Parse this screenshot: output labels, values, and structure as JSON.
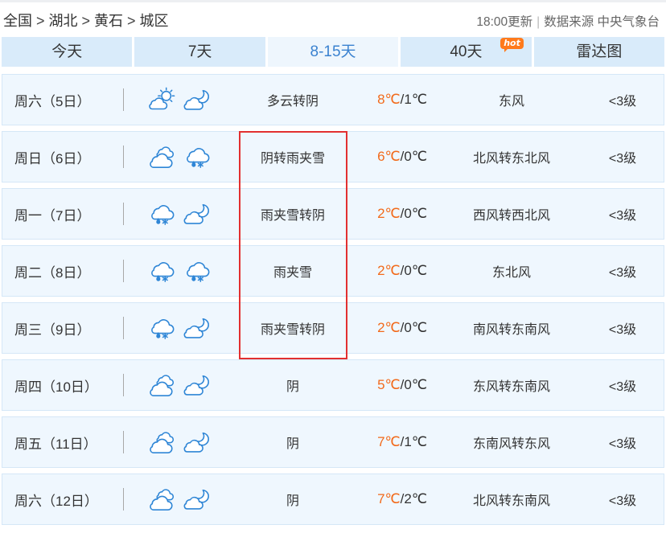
{
  "breadcrumb": {
    "items": [
      "全国",
      "湖北",
      "黄石",
      "城区"
    ],
    "separator": ">"
  },
  "header": {
    "update_time": "18:00更新",
    "divider": "|",
    "source": "数据来源 中央气象台"
  },
  "tabs": [
    {
      "label": "今天"
    },
    {
      "label": "7天"
    },
    {
      "label": "8-15天",
      "active": true
    },
    {
      "label": "40天",
      "badge": "hot"
    },
    {
      "label": "雷达图"
    }
  ],
  "temp_separator": "/",
  "forecast": [
    {
      "day": "周六（5日）",
      "icons": [
        "partly-cloudy-day-icon",
        "cloudy-night-icon"
      ],
      "weather": "多云转阴",
      "high": "8℃",
      "low": "1℃",
      "wind": "东风",
      "level": "<3级"
    },
    {
      "day": "周日（6日）",
      "icons": [
        "overcast-icon",
        "sleet-icon"
      ],
      "weather": "阴转雨夹雪",
      "high": "6℃",
      "low": "0℃",
      "wind": "北风转东北风",
      "level": "<3级"
    },
    {
      "day": "周一（7日）",
      "icons": [
        "sleet-icon",
        "cloudy-night-icon"
      ],
      "weather": "雨夹雪转阴",
      "high": "2℃",
      "low": "0℃",
      "wind": "西风转西北风",
      "level": "<3级"
    },
    {
      "day": "周二（8日）",
      "icons": [
        "sleet-icon",
        "sleet-icon"
      ],
      "weather": "雨夹雪",
      "high": "2℃",
      "low": "0℃",
      "wind": "东北风",
      "level": "<3级"
    },
    {
      "day": "周三（9日）",
      "icons": [
        "sleet-icon",
        "cloudy-night-icon"
      ],
      "weather": "雨夹雪转阴",
      "high": "2℃",
      "low": "0℃",
      "wind": "南风转东南风",
      "level": "<3级"
    },
    {
      "day": "周四（10日）",
      "icons": [
        "overcast-icon",
        "cloudy-night-icon"
      ],
      "weather": "阴",
      "high": "5℃",
      "low": "0℃",
      "wind": "东风转东南风",
      "level": "<3级"
    },
    {
      "day": "周五（11日）",
      "icons": [
        "overcast-icon",
        "cloudy-night-icon"
      ],
      "weather": "阴",
      "high": "7℃",
      "low": "1℃",
      "wind": "东南风转东风",
      "level": "<3级"
    },
    {
      "day": "周六（12日）",
      "icons": [
        "overcast-icon",
        "cloudy-night-icon"
      ],
      "weather": "阴",
      "high": "7℃",
      "low": "2℃",
      "wind": "北风转东南风",
      "level": "<3级"
    }
  ],
  "colors": {
    "icon_stroke": "#2f86d6",
    "temp_high": "#f26a1b",
    "tab_active_text": "#3a82d0",
    "hot_badge": "#ff7a1c",
    "highlight_box": "#e23030"
  }
}
